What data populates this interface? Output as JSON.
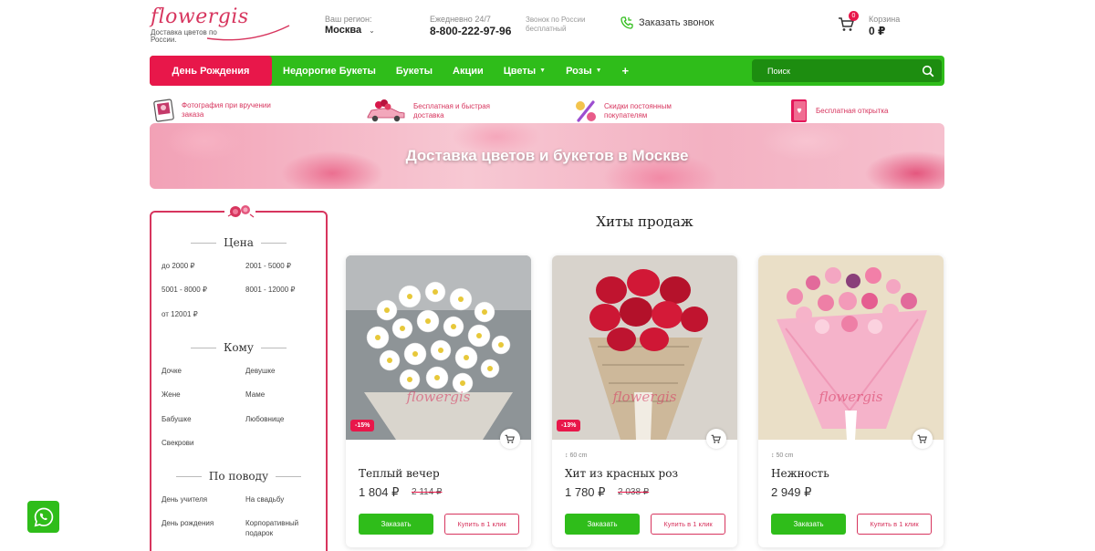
{
  "header": {
    "logo": {
      "word": "flowergis",
      "tagline": "Доставка цветов по России."
    },
    "region": {
      "label": "Ваш регион:",
      "value": "Москва"
    },
    "phone": {
      "label": "Ежедневно 24/7",
      "number": "8-800-222-97-96",
      "note": "Звонок по России бесплатный"
    },
    "callback_label": "Заказать звонок",
    "cart": {
      "label": "Корзина",
      "count": "0",
      "total": "0 ₽"
    }
  },
  "nav": {
    "items": [
      {
        "label": "День Рождения"
      },
      {
        "label": "Недорогие Букеты"
      },
      {
        "label": "Букеты"
      },
      {
        "label": "Акции"
      },
      {
        "label": "Цветы"
      },
      {
        "label": "Розы"
      }
    ],
    "more": "+",
    "search_placeholder": "Поиск"
  },
  "benefits": [
    {
      "text": "Фотография при вручении заказа",
      "icon": "photo-icon"
    },
    {
      "text": "Бесплатная и быстрая доставка",
      "icon": "delivery-car-icon"
    },
    {
      "text": "Скидки постоянным покупателям",
      "icon": "percent-discount-icon"
    },
    {
      "text": "Бесплатная открытка",
      "icon": "postcard-icon"
    }
  ],
  "banner": {
    "title": "Доставка цветов и букетов в Москве"
  },
  "filters": {
    "price": {
      "title": "Цена",
      "options": [
        "до 2000 ₽",
        "2001 - 5000 ₽",
        "5001 - 8000 ₽",
        "8001 - 12000 ₽",
        "от 12001 ₽"
      ]
    },
    "whom": {
      "title": "Кому",
      "options": [
        "Дочке",
        "Девушке",
        "Жене",
        "Маме",
        "Бабушке",
        "Любовнице",
        "Свекрови"
      ]
    },
    "occasion": {
      "title": "По поводу",
      "options": [
        "День учителя",
        "На свадьбу",
        "День рождения",
        "Корпоративный подарок"
      ]
    }
  },
  "products": {
    "title": "Хиты продаж",
    "watermark": "flowergis",
    "order_label": "Заказать",
    "oneclick_label": "Купить в 1 клик",
    "items": [
      {
        "name": "Теплый вечер",
        "price": "1 804 ₽",
        "old_price": "2 114 ₽",
        "discount": "-15%",
        "size": ""
      },
      {
        "name": "Хит из красных роз",
        "price": "1 780 ₽",
        "old_price": "2 038 ₽",
        "discount": "-13%",
        "size": "60 cm"
      },
      {
        "name": "Нежность",
        "price": "2 949 ₽",
        "old_price": "",
        "discount": "",
        "size": "50 cm"
      }
    ]
  },
  "colors": {
    "brand_pink": "#d7355e",
    "accent_red": "#e8174a",
    "green": "#2fbd1a",
    "dark_green": "#1d8d10"
  }
}
